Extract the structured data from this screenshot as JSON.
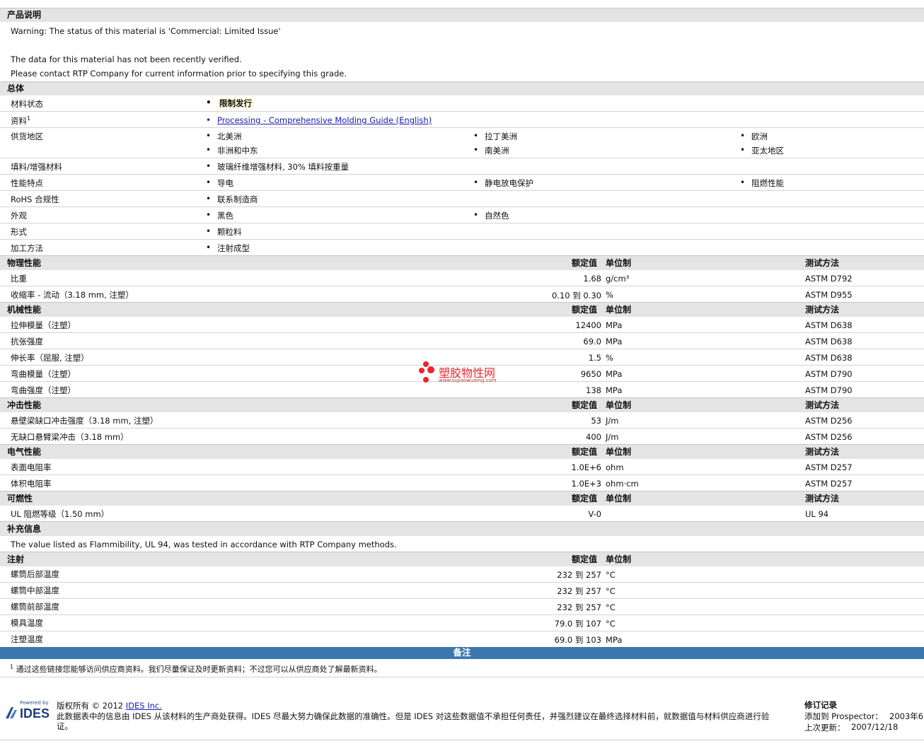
{
  "product_section": {
    "title": "产品说明",
    "lines": [
      "Warning: The status of this material is 'Commercial: Limited Issue'",
      "The data for this material has not been recently verified.",
      "Please contact RTP Company for current information prior to specifying this grade."
    ]
  },
  "general": {
    "title": "总体",
    "rows": [
      {
        "label": "材料状态",
        "values": [
          "限制发行"
        ]
      },
      {
        "label": "资料",
        "sup": "1",
        "values": [
          "Processing - Comprehensive Molding Guide (English)"
        ]
      },
      {
        "label": "供货地区",
        "values": [
          "北美洲",
          "拉丁美洲",
          "欧洲",
          "非洲和中东",
          "南美洲",
          "亚太地区"
        ]
      },
      {
        "label": "填料/增强材料",
        "values": [
          "玻璃纤维增强材料, 30% 填料按重量"
        ]
      },
      {
        "label": "性能特点",
        "values": [
          "导电",
          "静电放电保护",
          "阻燃性能"
        ]
      },
      {
        "label": "RoHS 合规性",
        "values": [
          "联系制造商"
        ]
      },
      {
        "label": "外观",
        "values": [
          "黑色",
          "自然色"
        ]
      },
      {
        "label": "形式",
        "values": [
          "颗粒料"
        ]
      },
      {
        "label": "加工方法",
        "values": [
          "注射成型"
        ]
      }
    ]
  },
  "col_headers": {
    "value": "额定值",
    "unit": "单位制",
    "method": "测试方法"
  },
  "physical": {
    "title": "物理性能",
    "rows": [
      {
        "label": "比重",
        "value": "1.68",
        "unit": "g/cm³",
        "method": "ASTM D792"
      },
      {
        "label": "收缩率 - 流动（3.18 mm, 注塑）",
        "value": "0.10 到  0.30",
        "unit": "%",
        "method": "ASTM D955"
      }
    ]
  },
  "mechanical": {
    "title": "机械性能",
    "rows": [
      {
        "label": "拉伸模量（注塑）",
        "value": "12400",
        "unit": "MPa",
        "method": "ASTM D638"
      },
      {
        "label": "抗张强度",
        "value": "69.0",
        "unit": "MPa",
        "method": "ASTM D638"
      },
      {
        "label": "伸长率（屈服, 注塑）",
        "value": "1.5",
        "unit": "%",
        "method": "ASTM D638"
      },
      {
        "label": "弯曲模量（注塑）",
        "value": "9650",
        "unit": "MPa",
        "method": "ASTM D790"
      },
      {
        "label": "弯曲强度（注塑）",
        "value": "138",
        "unit": "MPa",
        "method": "ASTM D790"
      }
    ]
  },
  "impact": {
    "title": "冲击性能",
    "rows": [
      {
        "label": "悬壁梁缺口冲击强度（3.18 mm, 注塑）",
        "value": "53",
        "unit": "J/m",
        "method": "ASTM D256"
      },
      {
        "label": "无缺口悬臂梁冲击（3.18 mm）",
        "value": "400",
        "unit": "J/m",
        "method": "ASTM D256"
      }
    ]
  },
  "electrical": {
    "title": "电气性能",
    "rows": [
      {
        "label": "表面电阻率",
        "value": "1.0E+6",
        "unit": "ohm",
        "method": "ASTM D257"
      },
      {
        "label": "体积电阻率",
        "value": "1.0E+3",
        "unit": "ohm·cm",
        "method": "ASTM D257"
      }
    ]
  },
  "flammability": {
    "title": "可燃性",
    "rows": [
      {
        "label": "UL 阻燃等级（1.50 mm）",
        "value": "V-0",
        "unit": "",
        "method": "UL 94"
      }
    ]
  },
  "supplement": {
    "title": "补充信息",
    "text": "The value listed as Flammibility, UL 94, was tested in accordance with RTP Company methods."
  },
  "injection": {
    "title": "注射",
    "rows": [
      {
        "label": "螺筒后部温度",
        "value": "232 到  257",
        "unit": "°C"
      },
      {
        "label": "螺筒中部温度",
        "value": "232 到  257",
        "unit": "°C"
      },
      {
        "label": "螺筒前部温度",
        "value": "232 到  257",
        "unit": "°C"
      },
      {
        "label": "模具温度",
        "value": "79.0 到  107",
        "unit": "°C"
      },
      {
        "label": "注塑温度",
        "value": "69.0 到  103",
        "unit": "MPa"
      }
    ]
  },
  "notes": {
    "title": "备注",
    "footnote_mark": "1",
    "footnote": "通过这些链接您能够访问供应商资料。我们尽量保证及时更新资料；不过您可以从供应商处了解最新资料。"
  },
  "watermark": {
    "name": "塑胶物性网",
    "url": "www.sujiaowuxing.com"
  },
  "footer": {
    "powered_by": "Powered by",
    "logo": "IDES",
    "copyright_prefix": "版权所有 © 2012 ",
    "copyright_link": "IDES Inc.",
    "disclaimer_line1": "此数据表中的信息由 IDES 从该材料的生产商处获得。IDES 尽最大努力确保此数据的准确性。但是 IDES 对这些数据值不承担任何责任，并强烈建议在最终选择材料前，就数据值与材料供应商进行验",
    "disclaimer_line2": "证。",
    "revision_title": "修订记录",
    "added_label": "添加到 Prospector：",
    "added_value": "2003年6",
    "updated_label": "上次更新：",
    "updated_value": "2007/12/18"
  }
}
